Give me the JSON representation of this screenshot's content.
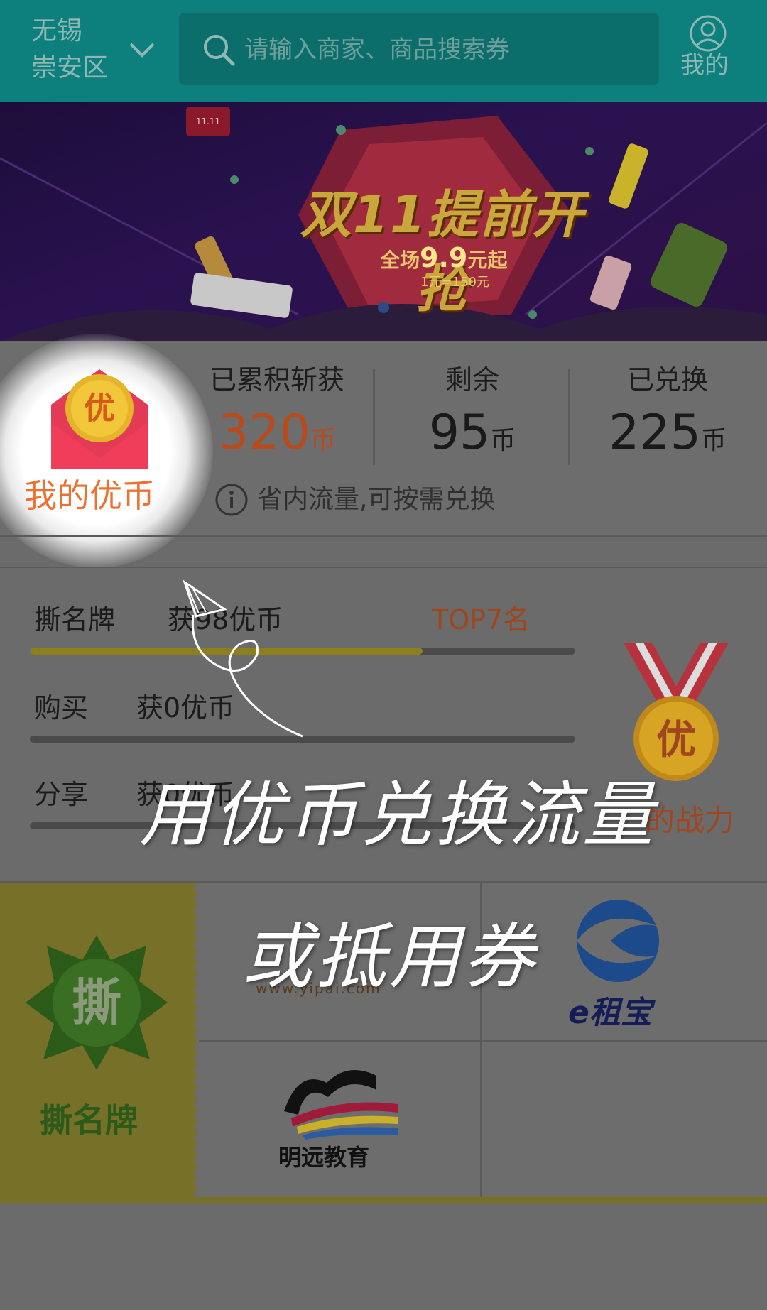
{
  "header": {
    "city_line1": "无锡",
    "city_line2": "崇安区",
    "search_placeholder": "请输入商家、商品搜索券",
    "profile_label": "我的"
  },
  "banner": {
    "tag": "11.11",
    "title": "双11提前开抢",
    "subtitle_prefix": "全场",
    "subtitle_price": "9.9",
    "subtitle_suffix": "元起",
    "rate": "1元=150元"
  },
  "coins": {
    "envelope_char": "优",
    "label": "我的优币",
    "stats": [
      {
        "title": "已累积斩获",
        "value": "320",
        "unit": "币"
      },
      {
        "title": "剩余",
        "value": "95",
        "unit": "币"
      },
      {
        "title": "已兑换",
        "value": "225",
        "unit": "币"
      }
    ],
    "info_text": "省内流量,可按需兑换"
  },
  "tasks": [
    {
      "label": "撕名牌",
      "reward": "获98优币",
      "progress": 0.72
    },
    {
      "label": "购买",
      "reward": "获0优币",
      "progress": 0
    },
    {
      "label": "分享",
      "reward": "获0优币",
      "progress": 0
    }
  ],
  "rank": {
    "top_text": "TOP7名",
    "medal_char": "优",
    "power_label": "的战力"
  },
  "cards": {
    "tear_char": "撕",
    "tear_label": "撕名牌",
    "logos": [
      {
        "name": "www.yipai.com"
      },
      {
        "name": "e租宝"
      },
      {
        "name": "明远教育"
      }
    ]
  },
  "overlay": {
    "line1": "用优币兑换流量",
    "line2": "或抵用券"
  },
  "colors": {
    "header_bg": "#0d7f7c",
    "accent_orange": "#ec7232",
    "progress_gold": "#8d7e1e",
    "tear_panel": "#767029"
  }
}
